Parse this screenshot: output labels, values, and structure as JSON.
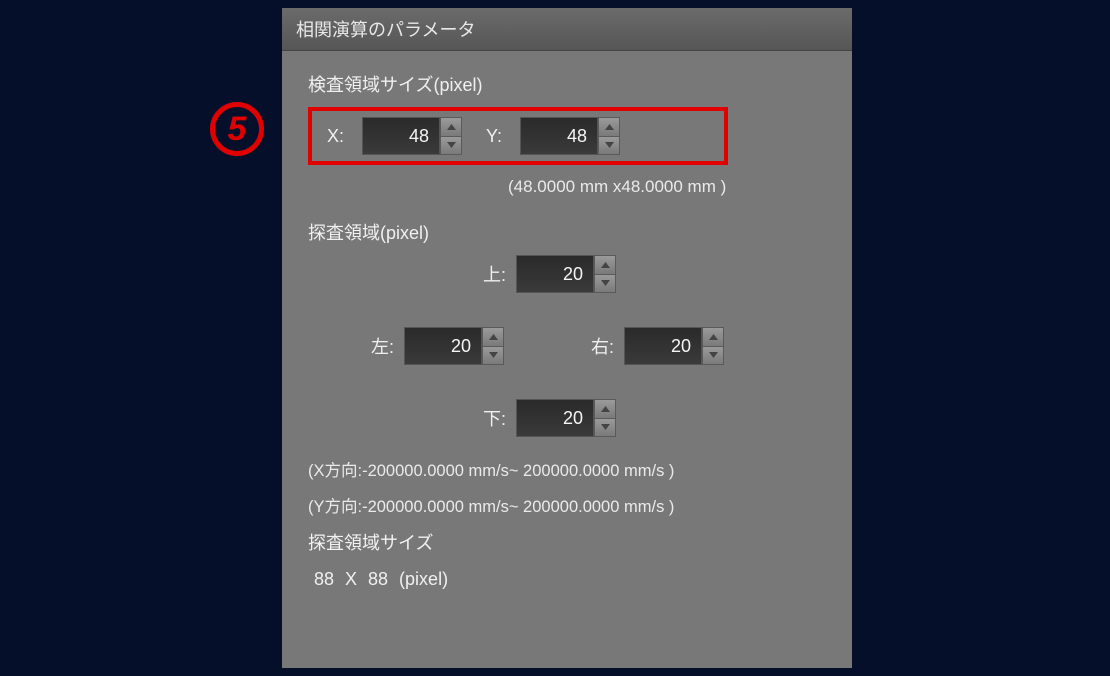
{
  "panel": {
    "title": "相関演算のパラメータ",
    "inspection": {
      "title": "検査領域サイズ(pixel)",
      "xLabel": "X:",
      "yLabel": "Y:",
      "xValue": "48",
      "yValue": "48",
      "mmInfo": "(48.0000 mm x48.0000 mm )"
    },
    "search": {
      "title": "探査領域(pixel)",
      "topLabel": "上:",
      "leftLabel": "左:",
      "rightLabel": "右:",
      "bottomLabel": "下:",
      "topValue": "20",
      "leftValue": "20",
      "rightValue": "20",
      "bottomValue": "20",
      "xRange": "(X方向:-200000.0000 mm/s~ 200000.0000 mm/s )",
      "yRange": "(Y方向:-200000.0000 mm/s~ 200000.0000 mm/s )",
      "sizeLabel": "探査領域サイズ",
      "sizeValue": " 88  X  88  (pixel)"
    }
  },
  "badge": {
    "label": "5"
  }
}
